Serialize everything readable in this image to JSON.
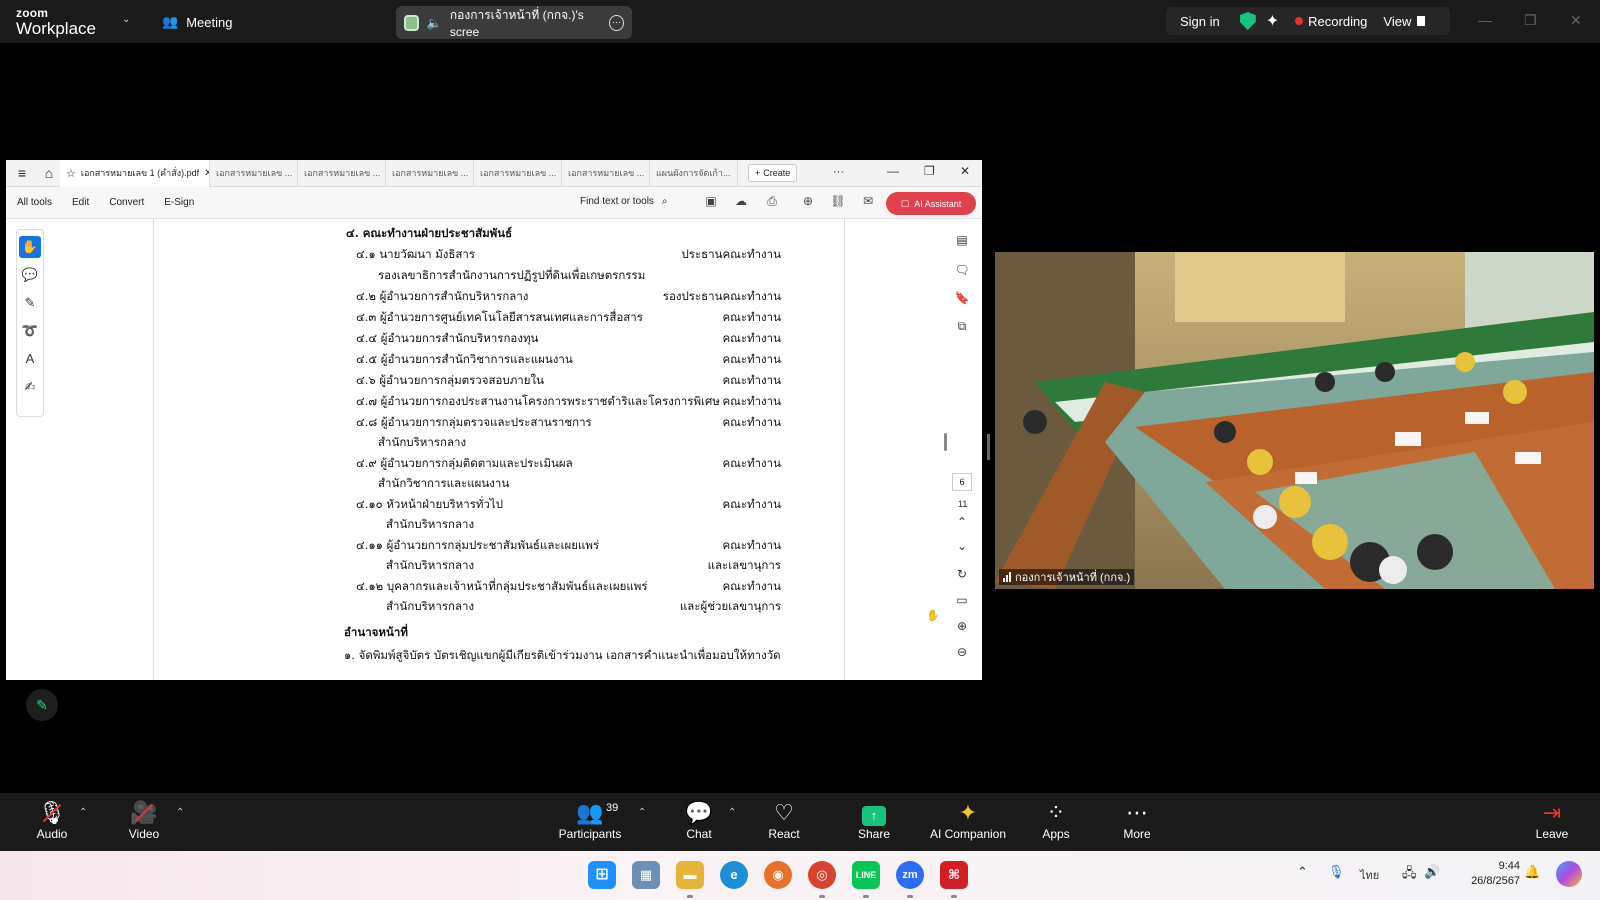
{
  "zoom": {
    "brand_top": "zoom",
    "brand_bottom": "Workplace",
    "meeting_label": "Meeting",
    "share_title": "กองการเจ้าหน้าที่ (กกจ.)'s scree",
    "signin": "Sign in",
    "recording": "Recording",
    "view": "View"
  },
  "pdf": {
    "tabs": [
      "เอกสารหมายเลข 1 (คำสั่ง).pdf",
      "เอกสารหมายเลข ...",
      "เอกสารหมายเลข ...",
      "เอกสารหมายเลข ...",
      "เอกสารหมายเลข ...",
      "เอกสารหมายเลข ...",
      "แผนผังการจัดเก้า..."
    ],
    "create": "Create",
    "menu": [
      "All tools",
      "Edit",
      "Convert",
      "E-Sign"
    ],
    "find_placeholder": "Find text or tools",
    "ai_assistant": "AI Assistant",
    "page_number": "6",
    "page_total": "11",
    "heading": "๔. คณะทำงานฝ่ายประชาสัมพันธ์",
    "rows": [
      {
        "text": "๔.๑ นายวัฒนา  มังธิสาร",
        "role": "ประธานคณะทำงาน"
      },
      {
        "text": "รองเลขาธิการสำนักงานการปฏิรูปที่ดินเพื่อเกษตรกรรม",
        "role": ""
      },
      {
        "text": "๔.๒ ผู้อำนวยการสำนักบริหารกลาง",
        "role": "รองประธานคณะทำงาน"
      },
      {
        "text": "๔.๓ ผู้อำนวยการศูนย์เทคโนโลยีสารสนเทศและการสื่อสาร",
        "role": "คณะทำงาน"
      },
      {
        "text": "๔.๔ ผู้อำนวยการสำนักบริหารกองทุน",
        "role": "คณะทำงาน"
      },
      {
        "text": "๔.๕ ผู้อำนวยการสำนักวิชาการและแผนงาน",
        "role": "คณะทำงาน"
      },
      {
        "text": "๔.๖ ผู้อำนวยการกลุ่มตรวจสอบภายใน",
        "role": "คณะทำงาน"
      },
      {
        "text": "๔.๗ ผู้อำนวยการกองประสานงานโครงการพระราชดำริและโครงการพิเศษ",
        "role": "คณะทำงาน"
      },
      {
        "text": "๔.๘ ผู้อำนวยการกลุ่มตรวจและประสานราชการ",
        "role": "คณะทำงาน"
      },
      {
        "text": "สำนักบริหารกลาง",
        "role": ""
      },
      {
        "text": "๔.๙ ผู้อำนวยการกลุ่มติดตามและประเมินผล",
        "role": "คณะทำงาน"
      },
      {
        "text": "สำนักวิชาการและแผนงาน",
        "role": ""
      },
      {
        "text": "๔.๑๐ หัวหน้าฝ่ายบริหารทั่วไป",
        "role": "คณะทำงาน"
      },
      {
        "text": "สำนักบริหารกลาง",
        "role": ""
      },
      {
        "text": "๔.๑๑ ผู้อำนวยการกลุ่มประชาสัมพันธ์และเผยแพร่",
        "role": "คณะทำงาน"
      },
      {
        "text": "สำนักบริหารกลาง",
        "role": "และเลขานุการ"
      },
      {
        "text": "๔.๑๒ บุคลากรและเจ้าหน้าที่กลุ่มประชาสัมพันธ์และเผยแพร่",
        "role": "คณะทำงาน"
      },
      {
        "text": "สำนักบริหารกลาง",
        "role": "และผู้ช่วยเลขานุการ"
      }
    ],
    "duty_heading": "อำนาจหน้าที่",
    "duty_line": "๑. จัดพิมพ์สูจิบัตร บัตรเชิญแขกผู้มีเกียรติเข้าร่วมงาน เอกสารคำแนะนำเพื่อมอบให้ทางวัด"
  },
  "video": {
    "name": "กองการเจ้าหน้าที่ (กกจ.)"
  },
  "controls": {
    "audio": "Audio",
    "video": "Video",
    "participants": "Participants",
    "participant_count": "39",
    "chat": "Chat",
    "react": "React",
    "share": "Share",
    "ai_companion": "AI Companion",
    "apps": "Apps",
    "more": "More",
    "leave": "Leave"
  },
  "taskbar": {
    "lang": "ไทย",
    "time": "9:44",
    "date": "26/8/2567",
    "zm_label": "zm"
  },
  "colors": {
    "recording": "#e8322b",
    "shield": "#19c37d",
    "ai_assistant": "#e3404e",
    "share": "#19c37d"
  }
}
